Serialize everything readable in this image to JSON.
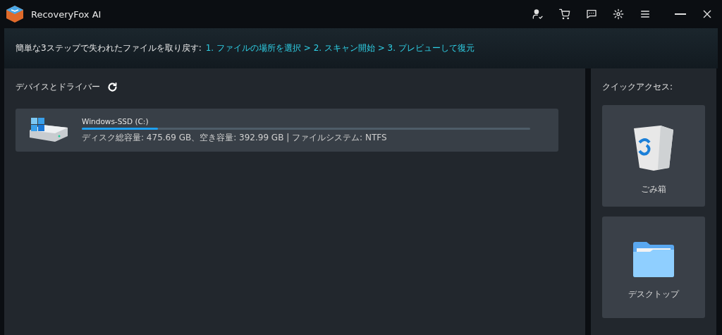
{
  "window": {
    "title": "RecoveryFox AI"
  },
  "banner": {
    "intro": "簡単な3ステップで失われたファイルを取り戻す:",
    "steps": "1. ファイルの場所を選択 > 2. スキャン開始 > 3. プレビューして復元"
  },
  "devices": {
    "heading": "デバイスとドライバー",
    "drives": [
      {
        "name": "Windows-SSD (C:)",
        "level": 0.17,
        "details": "ディスク総容量: 475.69 GB、空き容量: 392.99 GB | ファイルシステム: NTFS"
      }
    ]
  },
  "quick_access": {
    "heading": "クイックアクセス:",
    "items": [
      {
        "kind": "trash",
        "label": "ごみ箱"
      },
      {
        "kind": "folder",
        "label": "デスクトップ"
      }
    ]
  }
}
